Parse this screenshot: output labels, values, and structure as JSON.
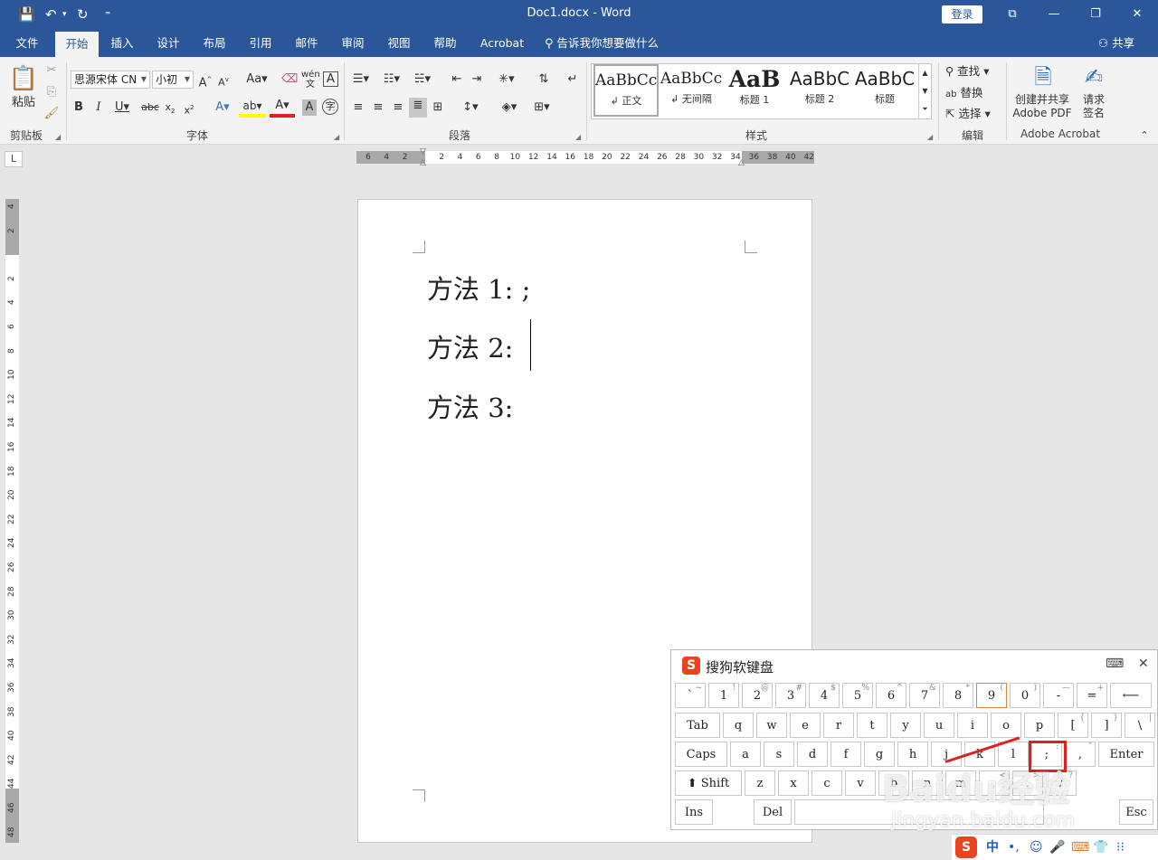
{
  "titlebar": {
    "doc_title": "Doc1.docx  -  Word",
    "login": "登录",
    "qa_save": "💾",
    "qa_undo": "↶",
    "qa_undo_arrow": "▾",
    "qa_redo": "↻",
    "qa_more": "⁼",
    "ribbon_display": "⧉",
    "minimize": "—",
    "restore": "❐",
    "close": "✕"
  },
  "tabs": [
    "文件",
    "开始",
    "插入",
    "设计",
    "布局",
    "引用",
    "邮件",
    "审阅",
    "视图",
    "帮助",
    "Acrobat"
  ],
  "tell_me": "告诉我你想要做什么",
  "share": "共享",
  "ribbon": {
    "clipboard": {
      "paste": "粘贴",
      "label": "剪贴板"
    },
    "font": {
      "name": "思源宋体 CN",
      "size": "小初",
      "label": "字体"
    },
    "paragraph": {
      "label": "段落"
    },
    "styles": {
      "label": "样式",
      "items": [
        {
          "sample": "AaBbCc",
          "name": "↲ 正文"
        },
        {
          "sample": "AaBbCc",
          "name": "↲ 无间隔"
        },
        {
          "sample": "AaB",
          "name": "标题 1"
        },
        {
          "sample": "AaBbC",
          "name": "标题 2"
        },
        {
          "sample": "AaBbC",
          "name": "标题"
        }
      ]
    },
    "editing": {
      "find": "查找",
      "replace": "替换",
      "select": "选择",
      "label": "编辑"
    },
    "acrobat": {
      "create_line1": "创建并共享",
      "create_line2": "Adobe PDF",
      "sign_line1": "请求",
      "sign_line2": "签名",
      "label": "Adobe Acrobat"
    }
  },
  "ruler": {
    "tab_selector": "L",
    "h_numbers": [
      "6",
      "4",
      "2",
      "",
      "2",
      "4",
      "6",
      "8",
      "10",
      "12",
      "14",
      "16",
      "18",
      "20",
      "22",
      "24",
      "26",
      "28",
      "30",
      "32",
      "34",
      "36",
      "38",
      "40",
      "42"
    ],
    "v_numbers": [
      "4",
      "2",
      "",
      "2",
      "4",
      "6",
      "8",
      "10",
      "12",
      "14",
      "16",
      "18",
      "20",
      "22",
      "24",
      "26",
      "28",
      "30",
      "32",
      "34",
      "36",
      "38",
      "40",
      "42",
      "44",
      "46",
      "48"
    ]
  },
  "document": {
    "lines": [
      "方法 1: ;",
      "方法 2:",
      "方法 3:"
    ]
  },
  "soft_keyboard": {
    "title": "搜狗软键盘",
    "rows": [
      [
        [
          "`",
          "~"
        ],
        [
          "1",
          "!"
        ],
        [
          "2",
          "@"
        ],
        [
          "3",
          "#"
        ],
        [
          "4",
          "$"
        ],
        [
          "5",
          "%"
        ],
        [
          "6",
          "^"
        ],
        [
          "7",
          "&"
        ],
        [
          "8",
          "*"
        ],
        [
          "9",
          "("
        ],
        [
          "0",
          ")"
        ],
        [
          "-",
          "—"
        ],
        [
          "=",
          "+"
        ],
        [
          "⟵",
          ""
        ]
      ],
      [
        [
          "Tab",
          ""
        ],
        [
          "q",
          ""
        ],
        [
          "w",
          ""
        ],
        [
          "e",
          ""
        ],
        [
          "r",
          ""
        ],
        [
          "t",
          ""
        ],
        [
          "y",
          ""
        ],
        [
          "u",
          ""
        ],
        [
          "i",
          ""
        ],
        [
          "o",
          ""
        ],
        [
          "p",
          ""
        ],
        [
          "[",
          "{"
        ],
        [
          "]",
          "}"
        ],
        [
          "\\",
          "|"
        ]
      ],
      [
        [
          "Caps",
          ""
        ],
        [
          "a",
          ""
        ],
        [
          "s",
          ""
        ],
        [
          "d",
          ""
        ],
        [
          "f",
          ""
        ],
        [
          "g",
          ""
        ],
        [
          "h",
          ""
        ],
        [
          "j",
          ""
        ],
        [
          "k",
          ""
        ],
        [
          "l",
          ""
        ],
        [
          ";",
          ":"
        ],
        [
          ",",
          "″"
        ],
        [
          "Enter",
          ""
        ]
      ],
      [
        [
          "⬆ Shift",
          ""
        ],
        [
          "z",
          ""
        ],
        [
          "x",
          ""
        ],
        [
          "c",
          ""
        ],
        [
          "v",
          ""
        ],
        [
          "b",
          ""
        ],
        [
          "n",
          ""
        ],
        [
          "m",
          ""
        ],
        [
          ",",
          "<"
        ],
        [
          ".",
          ">"
        ],
        [
          "/",
          "?"
        ]
      ],
      [
        [
          "Ins",
          ""
        ],
        [
          "Del",
          ""
        ],
        [
          "",
          ""
        ],
        [
          "Esc",
          ""
        ]
      ]
    ]
  },
  "ime_bar": [
    "S",
    "中",
    "•,",
    "☺",
    "🎤",
    "⌨",
    "👕",
    "⁝⁝"
  ],
  "watermark": {
    "main": "Baidu经验",
    "sub": "jingyan.baidu.com"
  }
}
